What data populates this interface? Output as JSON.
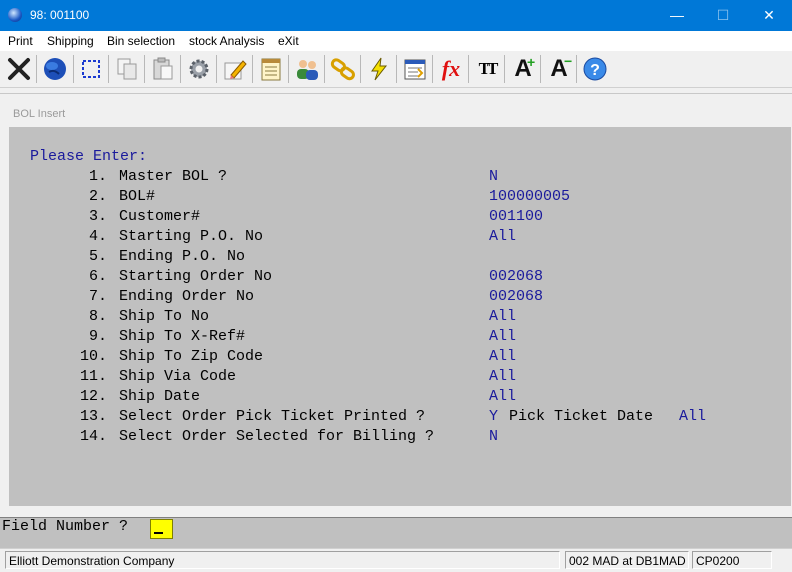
{
  "window": {
    "title": "98: 001100",
    "minimize": "—",
    "maximize": "☐",
    "close": "✕"
  },
  "menu": [
    "Print",
    "Shipping",
    "Bin selection",
    "stock Analysis",
    "eXit"
  ],
  "toolbar_icons": [
    "close-x-icon",
    "globe-icon",
    "select-box-icon",
    "copy-icon",
    "paste-icon",
    "settings-gear-icon",
    "edit-pencil-icon",
    "notepad-icon",
    "users-icon",
    "links-icon",
    "lightning-icon",
    "report-icon",
    "function-fx-icon",
    "font-tt-icon",
    "font-increase-icon",
    "font-decrease-icon",
    "help-icon"
  ],
  "toolbar_text": {
    "fx": "fx",
    "tt": "TT",
    "a_plus": "A",
    "a_minus": "A",
    "help": "?"
  },
  "child": {
    "title": "BOL Insert"
  },
  "prompt": "Please Enter:",
  "fields": [
    {
      "num": "1.",
      "label": "Master BOL ?",
      "value": "N"
    },
    {
      "num": "2.",
      "label": "BOL#",
      "value": "100000005"
    },
    {
      "num": "3.",
      "label": "Customer#",
      "value": "001100"
    },
    {
      "num": "4.",
      "label": "Starting P.O. No",
      "value": "All"
    },
    {
      "num": "5.",
      "label": "Ending P.O. No",
      "value": ""
    },
    {
      "num": "6.",
      "label": "Starting Order No",
      "value": "002068"
    },
    {
      "num": "7.",
      "label": "Ending Order No",
      "value": "002068"
    },
    {
      "num": "8.",
      "label": "Ship To No",
      "value": "All"
    },
    {
      "num": "9.",
      "label": "Ship To X-Ref#",
      "value": "All"
    },
    {
      "num": "10.",
      "label": "Ship To Zip Code",
      "value": "All"
    },
    {
      "num": "11.",
      "label": "Ship Via Code",
      "value": "All"
    },
    {
      "num": "12.",
      "label": "Ship Date",
      "value": "All"
    },
    {
      "num": "13.",
      "label": "Select Order Pick Ticket Printed ?",
      "value": "Y",
      "extra_label": "Pick Ticket Date",
      "extra_value": "All"
    },
    {
      "num": "14.",
      "label": "Select Order Selected for Billing ?",
      "value": "N"
    }
  ],
  "field_prompt": "Field Number ?",
  "status": {
    "company": "Elliott Demonstration Company",
    "db": "002 MAD at DB1MAD",
    "program": "CP0200"
  },
  "colors": {
    "titlebar": "#0078d7",
    "panel": "#c0c0c0",
    "value_text": "#1a1a9c",
    "cursor": "#ffff00"
  }
}
